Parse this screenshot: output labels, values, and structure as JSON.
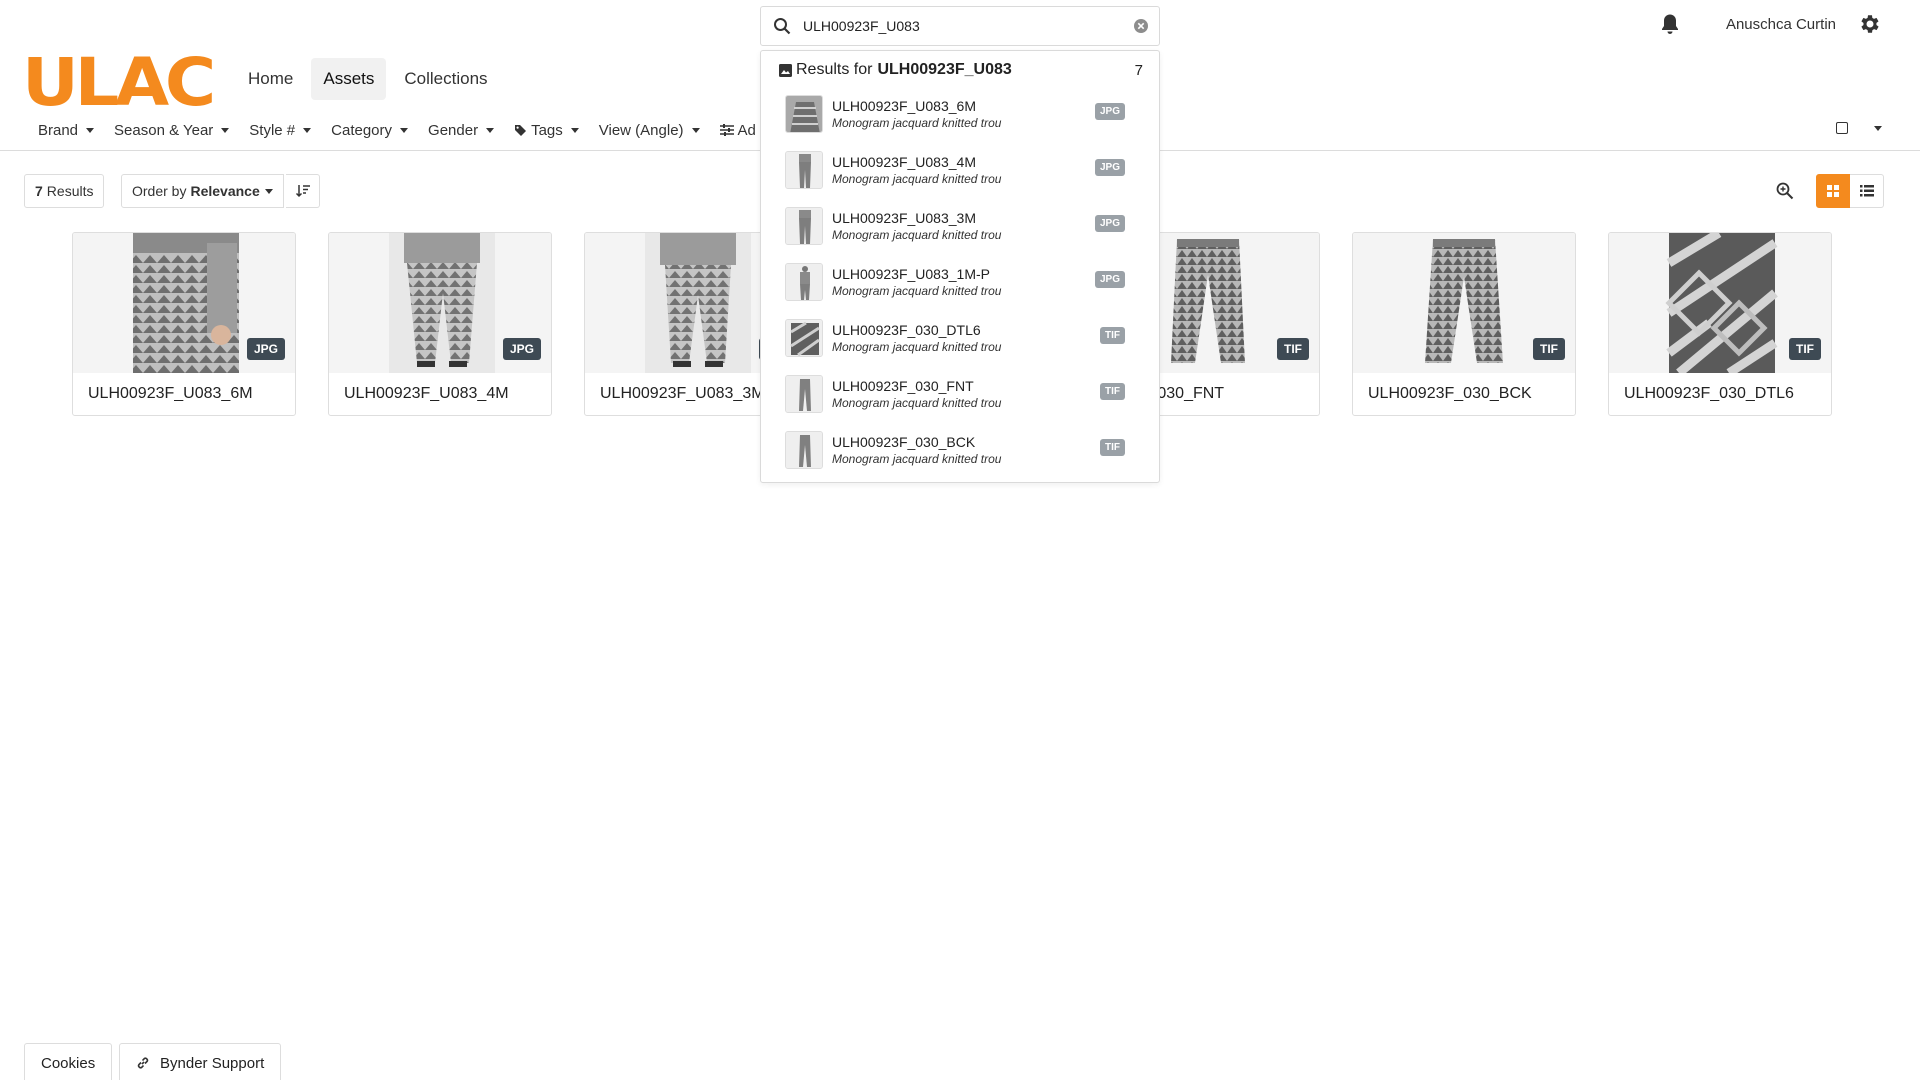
{
  "brand": {
    "logo_text": "ULAC",
    "accent_color": "#F48A1E"
  },
  "nav": {
    "items": [
      "Home",
      "Assets",
      "Collections"
    ],
    "active": "Assets"
  },
  "user": {
    "name": "Anuschca Curtin"
  },
  "search": {
    "value": "ULH00923F_U083",
    "placeholder": "Search"
  },
  "filters": [
    "Brand",
    "Season & Year",
    "Style #",
    "Category",
    "Gender",
    "Tags",
    "View (Angle)",
    "Ad"
  ],
  "toolbar": {
    "results_count": "7",
    "results_label": "Results",
    "order_prefix": "Order by",
    "order_value": "Relevance"
  },
  "assets": [
    {
      "name": "ULH00923F_U083_6M",
      "type": "JPG",
      "icon": "model-closeup-image"
    },
    {
      "name": "ULH00923F_U083_4M",
      "type": "JPG",
      "icon": "model-full-image"
    },
    {
      "name": "ULH00923F_U083_3M",
      "type": "JPG",
      "icon": "model-full-image"
    },
    {
      "name": "ULH00923F_U083_1M-P",
      "type": "JPG",
      "icon": "model-full-image"
    },
    {
      "name": "ULH00923F_030_FNT",
      "type": "TIF",
      "icon": "trousers-front-image"
    },
    {
      "name": "ULH00923F_030_BCK",
      "type": "TIF",
      "icon": "trousers-back-image"
    },
    {
      "name": "ULH00923F_030_DTL6",
      "type": "TIF",
      "icon": "fabric-detail-image"
    }
  ],
  "card_titles_visible": [
    "ULH00923F_U083_6M",
    "ULH00923F_U083_4M",
    "ULH00923F_U083_3M",
    "923F_030_FNT",
    "ULH00923F_030_BCK",
    "ULH00923F_030_DTL6"
  ],
  "dropdown": {
    "results_prefix": "Results for",
    "query": "ULH00923F_U083",
    "count": "7",
    "items": [
      {
        "name": "ULH00923F_U083_6M",
        "desc": "Monogram jacquard knitted trou",
        "type": "JPG"
      },
      {
        "name": "ULH00923F_U083_4M",
        "desc": "Monogram jacquard knitted trou",
        "type": "JPG"
      },
      {
        "name": "ULH00923F_U083_3M",
        "desc": "Monogram jacquard knitted trou",
        "type": "JPG"
      },
      {
        "name": "ULH00923F_U083_1M-P",
        "desc": "Monogram jacquard knitted trou",
        "type": "JPG"
      },
      {
        "name": "ULH00923F_030_DTL6",
        "desc": "Monogram jacquard knitted trou",
        "type": "TIF"
      },
      {
        "name": "ULH00923F_030_FNT",
        "desc": "Monogram jacquard knitted trou",
        "type": "TIF"
      },
      {
        "name": "ULH00923F_030_BCK",
        "desc": "Monogram jacquard knitted trou",
        "type": "TIF"
      }
    ]
  },
  "footer": {
    "cookies": "Cookies",
    "support": "Bynder Support"
  }
}
